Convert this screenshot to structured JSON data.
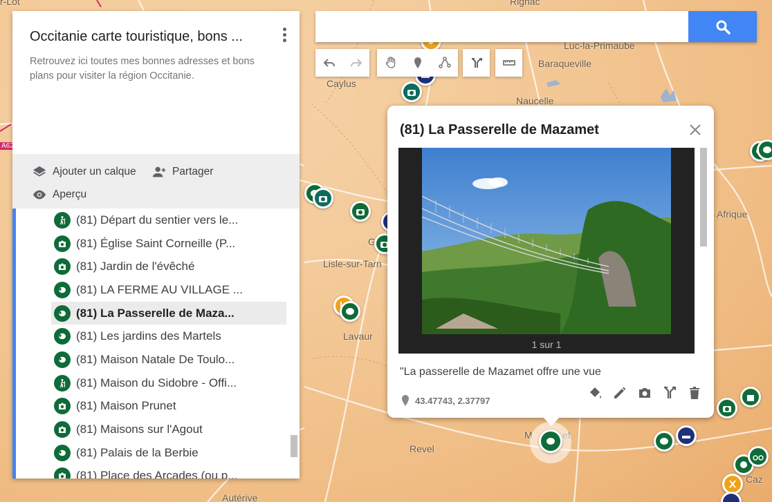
{
  "map": {
    "places": [
      "Rignac",
      "Luc-la-Primaube",
      "Baraqueville",
      "Caylus",
      "Naucelle",
      "Lisle-sur-Tarn",
      "Lavaur",
      "Revel",
      "Autérive",
      "Afrique",
      "Caz",
      "r-Lot",
      "A62",
      "G",
      "M",
      "et"
    ]
  },
  "panel": {
    "title": "Occitanie carte touristique, bons ...",
    "description": "Retrouvez ici toutes mes bonnes adresses et bons plans pour visiter la région Occitanie.",
    "add_layer": "Ajouter un calque",
    "share": "Partager",
    "preview": "Aperçu"
  },
  "items": [
    {
      "label": "(81) Départ du sentier vers le...",
      "icon": "hiker-icon"
    },
    {
      "label": "(81) Église Saint Corneille (P...",
      "icon": "camera-icon"
    },
    {
      "label": "(81) Jardin de l'évêché",
      "icon": "camera-icon"
    },
    {
      "label": "(81) LA FERME AU VILLAGE ...",
      "icon": "sheep-icon"
    },
    {
      "label": "(81) La Passerelle de Maza...",
      "icon": "sheep-icon",
      "selected": true
    },
    {
      "label": "(81) Les jardins des Martels",
      "icon": "sheep-icon"
    },
    {
      "label": "(81) Maison Natale De Toulo...",
      "icon": "sheep-icon"
    },
    {
      "label": "(81) Maison du Sidobre - Offi...",
      "icon": "hiker-icon"
    },
    {
      "label": "(81) Maison Prunet",
      "icon": "camera-icon"
    },
    {
      "label": "(81) Maisons sur l'Agout",
      "icon": "camera-icon"
    },
    {
      "label": "(81) Palais de la Berbie",
      "icon": "sheep-icon"
    },
    {
      "label": "(81) Place des Arcades (ou p...",
      "icon": "camera-icon"
    }
  ],
  "search": {
    "value": "",
    "placeholder": ""
  },
  "toolbar": [
    "undo-icon",
    "redo-icon",
    "hand-icon",
    "marker-icon",
    "draw-line-icon",
    "directions-icon",
    "ruler-icon"
  ],
  "info": {
    "title": "(81) La Passerelle de Mazamet",
    "photo_count": "1 sur 1",
    "description": "\"La passerelle de Mazamet offre une vue",
    "coords": "43.47743, 2.37797",
    "tools": [
      "paint-bucket-icon",
      "edit-icon",
      "camera-icon",
      "directions-icon",
      "delete-icon"
    ]
  },
  "colors": {
    "accent": "#4285f4",
    "pin_green": "#0f6b38",
    "pin_navy": "#1f2f7a",
    "pin_orange": "#f0a31a"
  }
}
